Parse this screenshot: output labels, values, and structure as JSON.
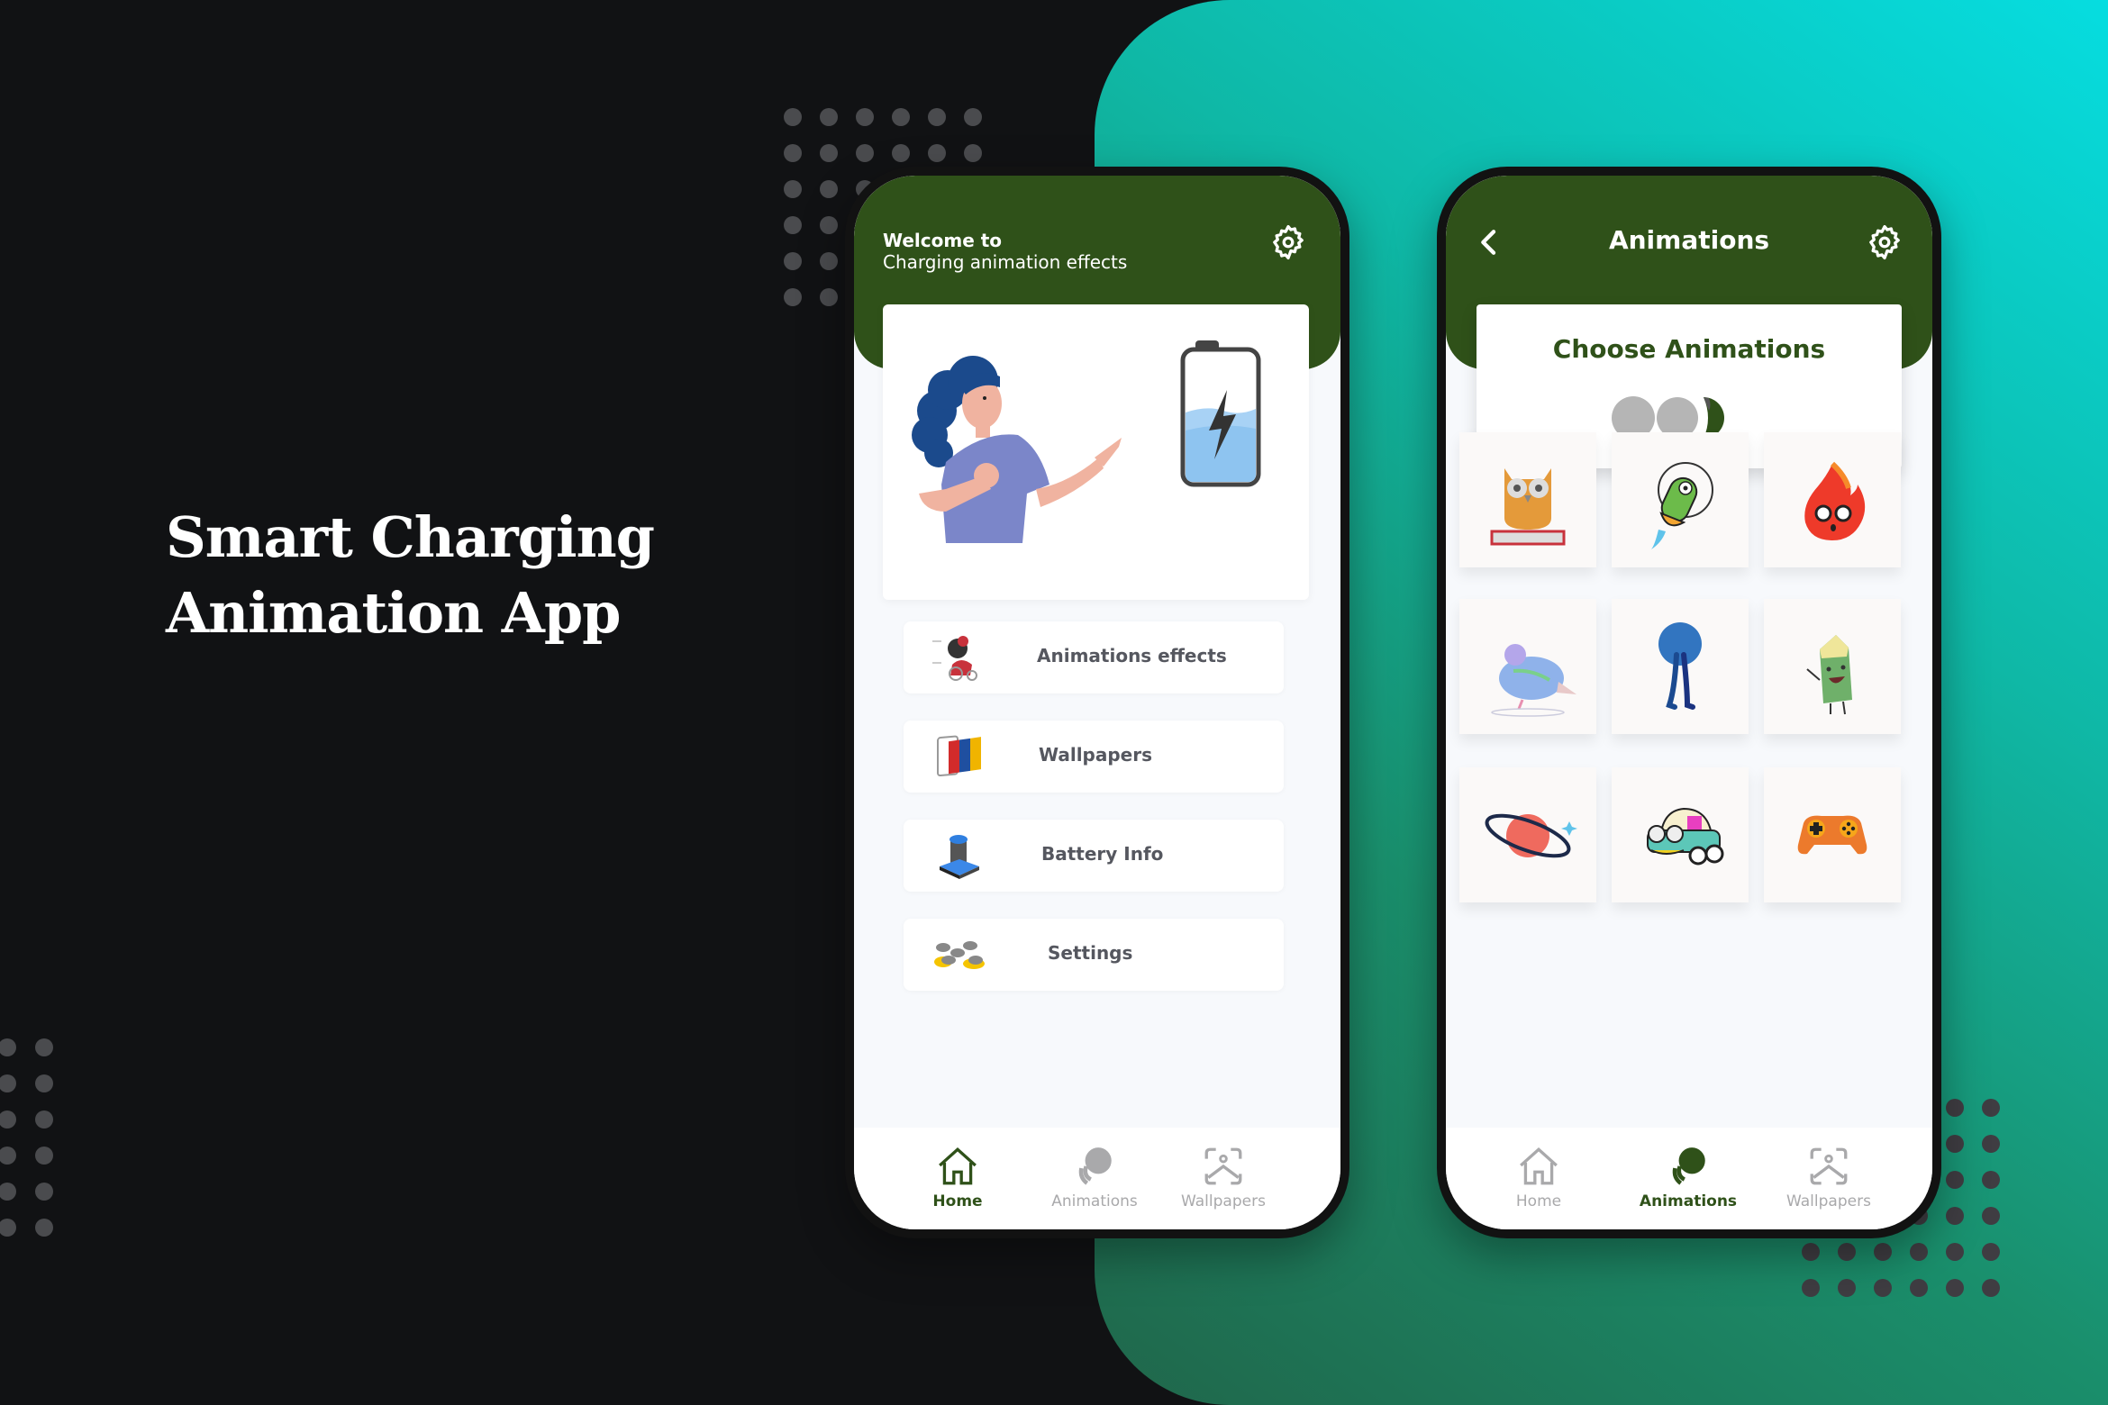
{
  "promo": {
    "title_line1": "Smart Charging",
    "title_line2": "Animation App"
  },
  "colors": {
    "header_green": "#2f5119",
    "background_dark": "#111214",
    "gradient_start": "#06dde0",
    "gradient_end": "#20664a",
    "nav_inactive": "#a9a9ab",
    "menu_text": "#55575f"
  },
  "home_screen": {
    "header": {
      "welcome": "Welcome to",
      "subtitle": "Charging animation effects",
      "settings_icon": "gear-icon"
    },
    "hero_illustration": "woman-pointing-at-charging-battery",
    "menu": [
      {
        "label": "Animations effects",
        "icon": "rooster-animation-icon"
      },
      {
        "label": "Wallpapers",
        "icon": "wallpaper-cards-icon"
      },
      {
        "label": "Battery Info",
        "icon": "battery-info-icon"
      },
      {
        "label": "Settings",
        "icon": "settings-coins-icon"
      }
    ],
    "bottom_nav": [
      {
        "label": "Home",
        "icon": "home-icon",
        "active": true
      },
      {
        "label": "Animations",
        "icon": "animations-icon",
        "active": false
      },
      {
        "label": "Wallpapers",
        "icon": "wallpaper-icon",
        "active": false
      }
    ]
  },
  "animations_screen": {
    "header": {
      "title": "Animations",
      "back_icon": "chevron-left-icon",
      "settings_icon": "gear-icon"
    },
    "choose_card": {
      "title": "Choose Animations",
      "loader": "loading-dots"
    },
    "grid": [
      {
        "name": "owl-on-book"
      },
      {
        "name": "alien-rocket"
      },
      {
        "name": "fire-face"
      },
      {
        "name": "pigeon"
      },
      {
        "name": "blue-ball-walker"
      },
      {
        "name": "green-pencil-character"
      },
      {
        "name": "planet-saturn"
      },
      {
        "name": "cartoon-car"
      },
      {
        "name": "game-controller"
      }
    ],
    "bottom_nav": [
      {
        "label": "Home",
        "icon": "home-icon",
        "active": false
      },
      {
        "label": "Animations",
        "icon": "animations-icon",
        "active": true
      },
      {
        "label": "Wallpapers",
        "icon": "wallpaper-icon",
        "active": false
      }
    ]
  }
}
